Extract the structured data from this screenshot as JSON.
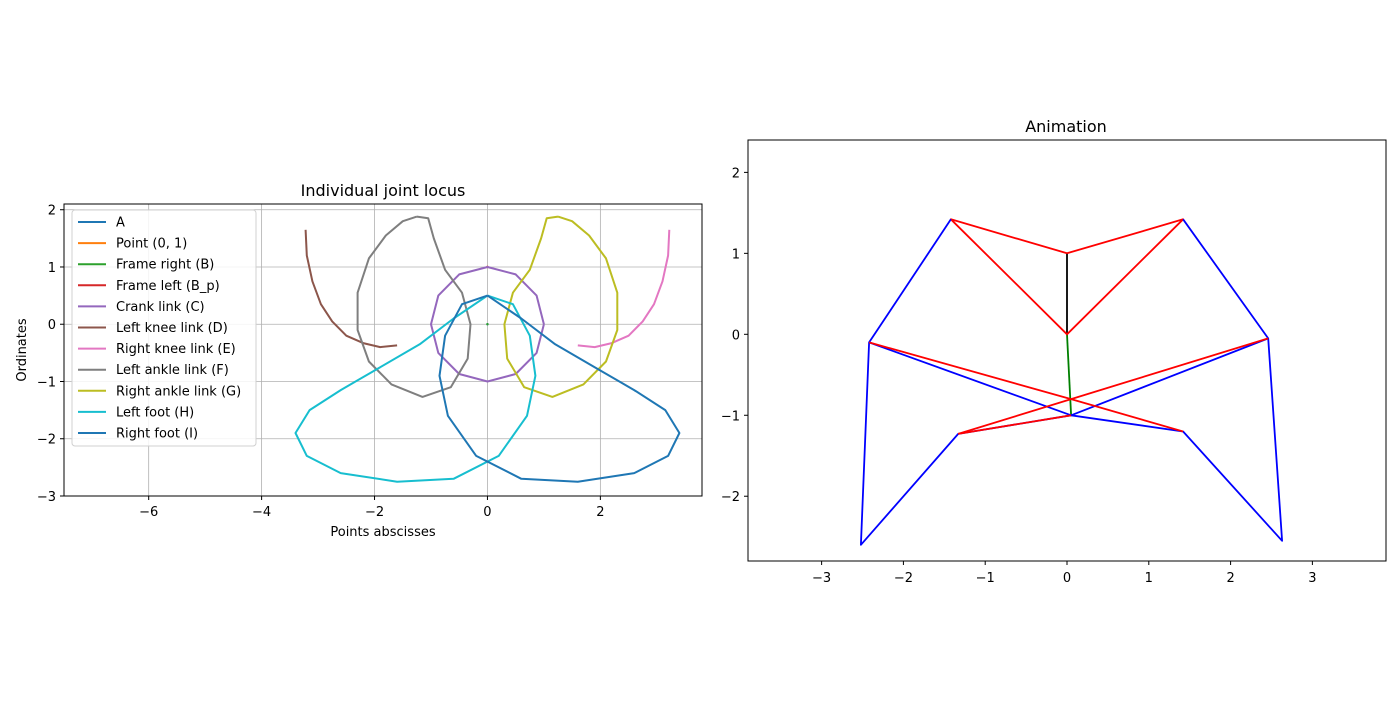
{
  "figure": {
    "background": "#ffffff"
  },
  "chart_data": [
    {
      "type": "line",
      "title": "Individual joint locus",
      "xlabel": "Points abscisses",
      "ylabel": "Ordinates",
      "xlim": [
        -7.5,
        3.8
      ],
      "ylim": [
        -3.0,
        2.1
      ],
      "xticks": [
        -6,
        -4,
        -2,
        0,
        2
      ],
      "yticks": [
        -3,
        -2,
        -1,
        0,
        1,
        2
      ],
      "grid": true,
      "legend_position": "upper-left",
      "series": [
        {
          "name": "A",
          "color": "#1f77b4",
          "x": [
            0
          ],
          "y": [
            0
          ]
        },
        {
          "name": "Point (0, 1)",
          "color": "#ff7f0e",
          "x": [
            0
          ],
          "y": [
            1
          ]
        },
        {
          "name": "Frame right (B)",
          "color": "#2ca02c",
          "x": [
            0
          ],
          "y": [
            0
          ]
        },
        {
          "name": "Frame left (B_p)",
          "color": "#d62728",
          "x": [
            0
          ],
          "y": [
            1
          ]
        },
        {
          "name": "Crank link (C)",
          "color": "#9467bd",
          "x": [
            1.0,
            0.87,
            0.5,
            0.0,
            -0.5,
            -0.87,
            -1.0,
            -0.87,
            -0.5,
            0.0,
            0.5,
            0.87,
            1.0
          ],
          "y": [
            0.0,
            0.5,
            0.87,
            1.0,
            0.87,
            0.5,
            0.0,
            -0.5,
            -0.87,
            -1.0,
            -0.87,
            -0.5,
            0.0
          ]
        },
        {
          "name": "Left knee link (D)",
          "color": "#8c564b",
          "x": [
            -3.22,
            -3.2,
            -3.1,
            -2.95,
            -2.75,
            -2.5,
            -2.2,
            -1.9,
            -1.6
          ],
          "y": [
            1.65,
            1.2,
            0.75,
            0.35,
            0.05,
            -0.2,
            -0.33,
            -0.4,
            -0.37
          ]
        },
        {
          "name": "Right knee link (E)",
          "color": "#e377c2",
          "x": [
            3.22,
            3.2,
            3.1,
            2.95,
            2.75,
            2.5,
            2.2,
            1.9,
            1.6
          ],
          "y": [
            1.65,
            1.2,
            0.75,
            0.35,
            0.05,
            -0.2,
            -0.33,
            -0.4,
            -0.37
          ]
        },
        {
          "name": "Left ankle link (F)",
          "color": "#7f7f7f",
          "x": [
            -1.25,
            -1.05,
            -0.95,
            -0.75,
            -0.45,
            -0.3,
            -0.35,
            -0.65,
            -1.15,
            -1.7,
            -2.1,
            -2.3,
            -2.3,
            -2.1,
            -1.8,
            -1.5,
            -1.25
          ],
          "y": [
            1.88,
            1.85,
            1.5,
            0.95,
            0.55,
            0.0,
            -0.6,
            -1.1,
            -1.27,
            -1.05,
            -0.65,
            -0.1,
            0.55,
            1.15,
            1.55,
            1.8,
            1.88
          ]
        },
        {
          "name": "Right ankle link (G)",
          "color": "#bcbd22",
          "x": [
            1.25,
            1.05,
            0.95,
            0.75,
            0.45,
            0.3,
            0.35,
            0.65,
            1.15,
            1.7,
            2.1,
            2.3,
            2.3,
            2.1,
            1.8,
            1.5,
            1.25
          ],
          "y": [
            1.88,
            1.85,
            1.5,
            0.95,
            0.55,
            0.0,
            -0.6,
            -1.1,
            -1.27,
            -1.05,
            -0.65,
            -0.1,
            0.55,
            1.15,
            1.55,
            1.8,
            1.88
          ]
        },
        {
          "name": "Left foot (H)",
          "color": "#17becf",
          "x": [
            0.0,
            -0.6,
            -1.2,
            -1.9,
            -2.6,
            -3.15,
            -3.4,
            -3.2,
            -2.6,
            -1.6,
            -0.6,
            0.2,
            0.7,
            0.85,
            0.75,
            0.45,
            0.0
          ],
          "y": [
            0.5,
            0.1,
            -0.35,
            -0.75,
            -1.15,
            -1.5,
            -1.9,
            -2.3,
            -2.6,
            -2.75,
            -2.7,
            -2.3,
            -1.6,
            -0.9,
            -0.2,
            0.35,
            0.5
          ]
        },
        {
          "name": "Right foot (I)",
          "color": "#1f77b4",
          "x": [
            0.0,
            0.6,
            1.2,
            1.9,
            2.6,
            3.15,
            3.4,
            3.2,
            2.6,
            1.6,
            0.6,
            -0.2,
            -0.7,
            -0.85,
            -0.75,
            -0.45,
            0.0
          ],
          "y": [
            0.5,
            0.1,
            -0.35,
            -0.75,
            -1.15,
            -1.5,
            -1.9,
            -2.3,
            -2.6,
            -2.75,
            -2.7,
            -2.3,
            -1.6,
            -0.9,
            -0.2,
            0.35,
            0.5
          ]
        }
      ]
    },
    {
      "type": "line",
      "title": "Animation",
      "xlabel": "",
      "ylabel": "",
      "xlim": [
        -3.9,
        3.9
      ],
      "ylim": [
        -2.8,
        2.4
      ],
      "xticks": [
        -3,
        -2,
        -1,
        0,
        1,
        2,
        3
      ],
      "yticks": [
        -2,
        -1,
        0,
        1,
        2
      ],
      "grid": false,
      "segments": [
        {
          "color": "#000000",
          "points": [
            [
              0,
              1
            ],
            [
              0,
              0
            ]
          ]
        },
        {
          "color": "#008000",
          "points": [
            [
              0,
              0
            ],
            [
              0.05,
              -1.0
            ]
          ]
        },
        {
          "color": "#ff0000",
          "points": [
            [
              0,
              1
            ],
            [
              -1.42,
              1.42
            ],
            [
              0,
              0
            ],
            [
              1.42,
              1.42
            ],
            [
              0,
              1
            ]
          ]
        },
        {
          "color": "#0000ff",
          "points": [
            [
              -1.42,
              1.42
            ],
            [
              -2.42,
              -0.1
            ],
            [
              -2.52,
              -2.6
            ],
            [
              -1.33,
              -1.23
            ],
            [
              0.05,
              -1.0
            ],
            [
              1.42,
              -1.2
            ],
            [
              2.63,
              -2.55
            ],
            [
              2.46,
              -0.05
            ],
            [
              1.42,
              1.42
            ]
          ]
        },
        {
          "color": "#0000ff",
          "points": [
            [
              -2.42,
              -0.1
            ],
            [
              0.05,
              -1.0
            ],
            [
              2.46,
              -0.05
            ]
          ]
        },
        {
          "color": "#ff0000",
          "points": [
            [
              -2.42,
              -0.1
            ],
            [
              0.05,
              -0.8
            ],
            [
              2.46,
              -0.05
            ]
          ]
        },
        {
          "color": "#ff0000",
          "points": [
            [
              -1.33,
              -1.23
            ],
            [
              0.05,
              -0.8
            ],
            [
              1.42,
              -1.2
            ]
          ]
        },
        {
          "color": "#ff0000",
          "points": [
            [
              -1.33,
              -1.23
            ],
            [
              0.05,
              -1.0
            ]
          ]
        }
      ]
    }
  ]
}
